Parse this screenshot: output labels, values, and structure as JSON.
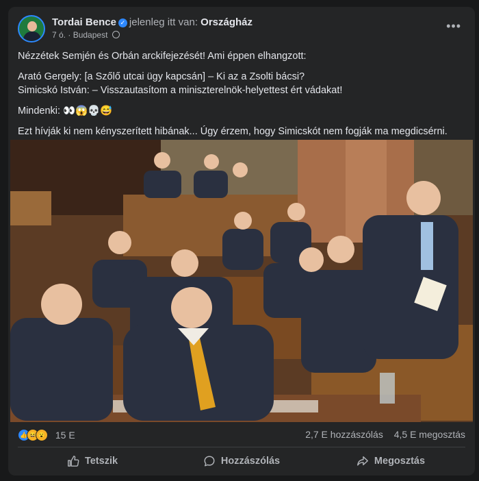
{
  "post": {
    "author": "Tordai Bence",
    "location_prefix": "jelenleg itt van:",
    "location": "Országház",
    "time": "7 ó.",
    "separator": "·",
    "city": "Budapest",
    "more_label": "•••",
    "paragraphs": {
      "p1": "Nézzétek Semjén és Orbán arckifejezését! Ami éppen elhangzott:",
      "p2_line1": "Arató Gergely: [a Szőlő utcai ügy kapcsán] – Ki az a Zsolti bácsi?",
      "p2_line2": "Simicskó István: – Visszautasítom a miniszterelnök-helyettest ért vádakat!",
      "p3": "Mindenki: 👀😱💀😅",
      "p4": "Ezt hívják ki nem kényszerített hibának... Úgy érzem, hogy Simicskót nem fogják ma megdicsérni."
    }
  },
  "stats": {
    "reactions_count": "15 E",
    "comments": "2,7 E hozzászólás",
    "shares": "4,5 E megosztás",
    "reaction_icons": [
      "like-reaction-icon",
      "haha-reaction-icon",
      "wow-reaction-icon"
    ]
  },
  "actions": {
    "like": "Tetszik",
    "comment": "Hozzászólás",
    "share": "Megosztás"
  },
  "colors": {
    "background": "#18191a",
    "card": "#242526",
    "accent": "#2d88ff",
    "text": "#e4e6eb",
    "secondary_text": "#b0b3b8",
    "tie_orange": "#e0a020"
  }
}
